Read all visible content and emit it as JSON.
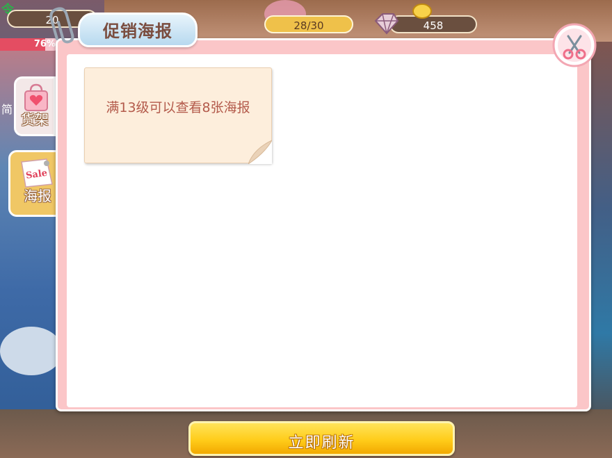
{
  "hud": {
    "top_left_glyph": "令",
    "coins_partial": "20",
    "progress_percent_label": "76%",
    "progress_percent_value": 76,
    "stock": "28/30",
    "gems": "458"
  },
  "side_tabs": {
    "shelf_label": "货架",
    "poster_label": "海报",
    "left_partial_text": "简"
  },
  "dialog": {
    "title": "促销海报"
  },
  "poster_slot": {
    "message": "满13级可以查看8张海报"
  },
  "actions": {
    "refresh_label": "立即刷新"
  },
  "colors": {
    "dialog_border": "#fbc6c8",
    "note_bg": "#fdeedc",
    "note_text": "#b35a4b",
    "button_yellow": "#ffcc1a",
    "title_text": "#7a4d3f"
  }
}
